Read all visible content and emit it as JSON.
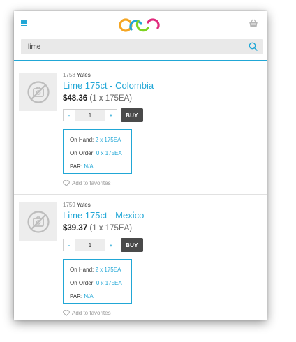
{
  "search": {
    "value": "lime"
  },
  "products": [
    {
      "sku": "1758",
      "vendor": "Yates",
      "title": "Lime 175ct - Colombia",
      "price": "$48.36",
      "pack": "(1 x 175EA)",
      "qty_minus": "-",
      "qty": "1",
      "qty_plus": "+",
      "buy_label": "BUY",
      "on_hand_label": "On Hand:",
      "on_hand": "2 x 175EA",
      "on_order_label": "On Order:",
      "on_order": "0 x 175EA",
      "par_label": "PAR:",
      "par": "N/A",
      "favorites_label": "Add to favorites"
    },
    {
      "sku": "1759",
      "vendor": "Yates",
      "title": "Lime 175ct - Mexico",
      "price": "$39.37",
      "pack": "(1 x 175EA)",
      "qty_minus": "-",
      "qty": "1",
      "qty_plus": "+",
      "buy_label": "BUY",
      "on_hand_label": "On Hand:",
      "on_hand": "2 x 175EA",
      "on_order_label": "On Order:",
      "on_order": "0 x 175EA",
      "par_label": "PAR:",
      "par": "N/A",
      "favorites_label": "Add to favorites"
    }
  ],
  "colors": {
    "accent": "#21a7d6",
    "buy_button": "#4a4a4a",
    "logo": [
      "#f5a623",
      "#21a7d6",
      "#7ed321",
      "#e0297c"
    ]
  },
  "icons": {
    "menu": "hamburger-icon",
    "cart": "basket-icon",
    "search": "search-icon",
    "thumb": "no-image-icon",
    "favorite": "heart-icon"
  }
}
